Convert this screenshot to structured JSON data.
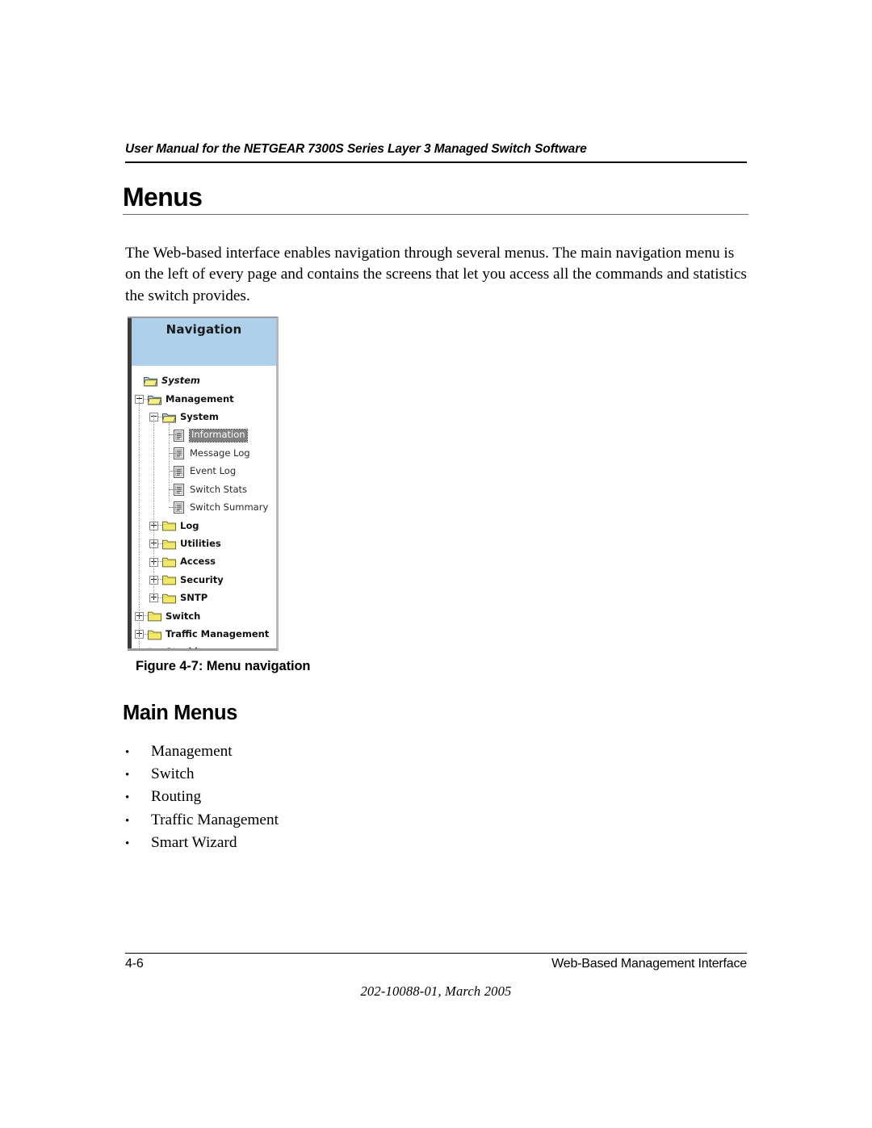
{
  "header": {
    "running_title": "User Manual for the NETGEAR 7300S Series Layer 3 Managed Switch Software"
  },
  "h1": "Menus",
  "intro_paragraph": "The Web-based interface enables navigation through several menus. The main navigation menu is on the left of every page and contains the screens that let you access all the commands and statistics the switch provides.",
  "figure": {
    "panel_title": "Navigation",
    "caption": "Figure 4-7:  Menu navigation",
    "colors": {
      "title_bar": "#aed0ea",
      "selection": "#808080",
      "folder": "#f2e96b",
      "left_bar": "#3c3c3c"
    },
    "tree": [
      {
        "label": "System",
        "level": 0,
        "type": "folder-open",
        "expander": "none",
        "style": "italic",
        "selected": false
      },
      {
        "label": "Management",
        "level": 0,
        "type": "folder-open",
        "expander": "minus",
        "style": "bold",
        "selected": false
      },
      {
        "label": "System",
        "level": 1,
        "type": "folder-open",
        "expander": "minus",
        "style": "bold",
        "selected": false
      },
      {
        "label": "Information",
        "level": 2,
        "type": "document",
        "expander": "none",
        "style": "normal",
        "selected": true
      },
      {
        "label": "Message Log",
        "level": 2,
        "type": "document",
        "expander": "none",
        "style": "normal",
        "selected": false
      },
      {
        "label": "Event Log",
        "level": 2,
        "type": "document",
        "expander": "none",
        "style": "normal",
        "selected": false
      },
      {
        "label": "Switch Stats",
        "level": 2,
        "type": "document",
        "expander": "none",
        "style": "normal",
        "selected": false
      },
      {
        "label": "Switch Summary",
        "level": 2,
        "type": "document",
        "expander": "none",
        "style": "normal",
        "selected": false
      },
      {
        "label": "Log",
        "level": 1,
        "type": "folder-closed",
        "expander": "plus",
        "style": "bold",
        "selected": false
      },
      {
        "label": "Utilities",
        "level": 1,
        "type": "folder-closed",
        "expander": "plus",
        "style": "bold",
        "selected": false
      },
      {
        "label": "Access",
        "level": 1,
        "type": "folder-closed",
        "expander": "plus",
        "style": "bold",
        "selected": false
      },
      {
        "label": "Security",
        "level": 1,
        "type": "folder-closed",
        "expander": "plus",
        "style": "bold",
        "selected": false
      },
      {
        "label": "SNTP",
        "level": 1,
        "type": "folder-closed",
        "expander": "plus",
        "style": "bold",
        "selected": false
      },
      {
        "label": "Switch",
        "level": 0,
        "type": "folder-closed",
        "expander": "plus",
        "style": "bold",
        "selected": false
      },
      {
        "label": "Traffic Management",
        "level": 0,
        "type": "folder-closed",
        "expander": "plus",
        "style": "bold",
        "selected": false
      },
      {
        "label": "Stacking",
        "level": 0,
        "type": "folder-closed",
        "expander": "plus",
        "style": "bold",
        "selected": false
      }
    ]
  },
  "h2": "Main Menus",
  "main_menus": [
    "Management",
    "Switch",
    "Routing",
    "Traffic Management",
    "Smart Wizard"
  ],
  "bullet_glyph": "•",
  "footer": {
    "page_number": "4-6",
    "section": "Web-Based Management Interface",
    "doc_id": "202-10088-01, March 2005"
  }
}
